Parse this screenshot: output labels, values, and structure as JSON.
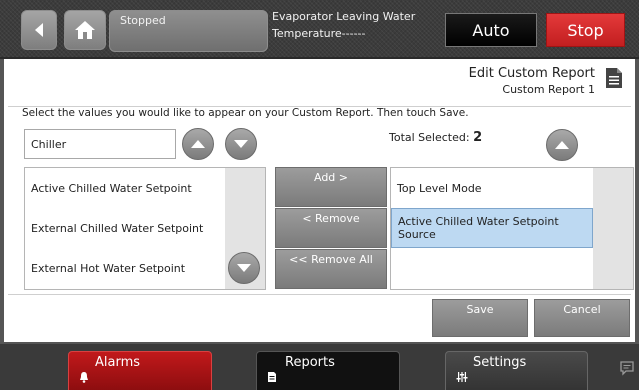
{
  "header": {
    "status": "Stopped",
    "evap_label": "Evaporator Leaving Water",
    "evap_value": "Temperature------",
    "auto_label": "Auto",
    "stop_label": "Stop"
  },
  "page": {
    "title": "Edit Custom Report",
    "subtitle": "Custom Report 1",
    "instructions": "Select the values you would like to appear on your Custom Report. Then touch Save.",
    "total_selected_label": "Total Selected:",
    "total_selected_count": "2",
    "category": "Chiller"
  },
  "available_items": [
    "Active Chilled Water Setpoint",
    "External Chilled Water Setpoint",
    "External Hot Water Setpoint"
  ],
  "selected_items": [
    "Top Level Mode",
    "Active Chilled Water Setpoint Source"
  ],
  "buttons": {
    "add": "Add >",
    "remove": "< Remove",
    "remove_all": "<< Remove All",
    "save": "Save",
    "cancel": "Cancel"
  },
  "nav": {
    "alarms": "Alarms",
    "reports": "Reports",
    "settings": "Settings"
  },
  "icons": {
    "back": "back-arrow-icon",
    "home": "home-icon",
    "report": "report-document-icon",
    "up": "chevron-up-icon",
    "down": "chevron-down-icon",
    "bell": "bell-icon",
    "document": "document-icon",
    "sliders": "sliders-icon",
    "chat": "chat-icon"
  },
  "colors": {
    "stop": "#d42d2e",
    "alarms": "#a81315",
    "selected_row": "#bdd9f2"
  }
}
